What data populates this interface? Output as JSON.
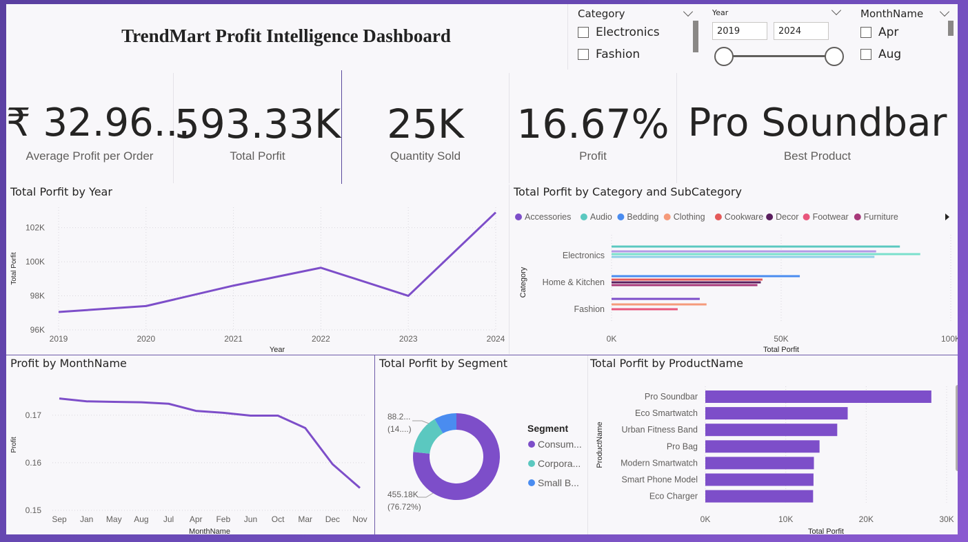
{
  "header": {
    "title": "TrendMart Profit Intelligence Dashboard"
  },
  "slicers": {
    "category": {
      "label": "Category",
      "options": [
        "Electronics",
        "Fashion"
      ]
    },
    "year": {
      "label": "Year",
      "from": "2019",
      "to": "2024"
    },
    "month": {
      "label": "MonthName",
      "options": [
        "Apr",
        "Aug"
      ]
    }
  },
  "kpis": [
    {
      "value": "₹ 32.96...",
      "label": "Average Profit per Order"
    },
    {
      "value": "593.33K",
      "label": "Total Porfit"
    },
    {
      "value": "25K",
      "label": "Quantity Sold"
    },
    {
      "value": "16.67%",
      "label": "Profit"
    },
    {
      "value": "Pro Soundbar",
      "label": "Best Product"
    }
  ],
  "colors": {
    "primary": "#7d4ec9",
    "grid": "#d8d6dc"
  },
  "chart_data": [
    {
      "id": "year",
      "type": "line",
      "title": "Total Porfit by Year",
      "xlabel": "Year",
      "ylabel": "Total Porfit",
      "x": [
        "2019",
        "2020",
        "2021",
        "2022",
        "2023",
        "2024"
      ],
      "values": [
        97050,
        97400,
        98600,
        99650,
        98000,
        102900
      ],
      "ylim": [
        96000,
        103200
      ],
      "yticks": [
        96000,
        98000,
        100000,
        102000
      ],
      "ytick_labels": [
        "96K",
        "98K",
        "100K",
        "102K"
      ],
      "grid": true
    },
    {
      "id": "catsub",
      "type": "bar",
      "title": "Total Porfit by Category and SubCategory",
      "xlabel": "Total Porfit",
      "ylabel": "Category",
      "legend_position": "top",
      "legend": [
        {
          "name": "Accessories",
          "color": "#7d4ec9"
        },
        {
          "name": "Audio",
          "color": "#5bc8c0"
        },
        {
          "name": "Bedding",
          "color": "#4a8cf0"
        },
        {
          "name": "Clothing",
          "color": "#f59a7a"
        },
        {
          "name": "Cookware",
          "color": "#e45a5a"
        },
        {
          "name": "Decor",
          "color": "#5a1e5e"
        },
        {
          "name": "Footwear",
          "color": "#e8567c"
        },
        {
          "name": "Furniture",
          "color": "#a8397a"
        }
      ],
      "categories": [
        "Electronics",
        "Home & Kitchen",
        "Fashion"
      ],
      "bars": [
        [
          {
            "color": "#5bc8c0",
            "value": 85000
          },
          {
            "color": "#b39ae6",
            "value": 78000
          },
          {
            "color": "#7be0cc",
            "value": 91000
          },
          {
            "color": "#8fd0e6",
            "value": 77500
          }
        ],
        [
          {
            "color": "#4a8cf0",
            "value": 55500
          },
          {
            "color": "#e45a5a",
            "value": 44500
          },
          {
            "color": "#5a1e5e",
            "value": 44000
          },
          {
            "color": "#a8397a",
            "value": 43000
          }
        ],
        [
          {
            "color": "#7d4ec9",
            "value": 26000
          },
          {
            "color": "#f59a7a",
            "value": 28000
          },
          {
            "color": "#e8567c",
            "value": 19500
          }
        ]
      ],
      "xlim": [
        0,
        100000
      ],
      "xticks": [
        0,
        50000,
        100000
      ],
      "xtick_labels": [
        "0K",
        "50K",
        "100K"
      ]
    },
    {
      "id": "month",
      "type": "line",
      "title": "Profit by MonthName",
      "xlabel": "MonthName",
      "ylabel": "Profit",
      "x": [
        "Sep",
        "Jan",
        "May",
        "Aug",
        "Jul",
        "Apr",
        "Feb",
        "Jun",
        "Oct",
        "Mar",
        "Dec",
        "Nov"
      ],
      "values": [
        0.1735,
        0.1729,
        0.1728,
        0.1727,
        0.1724,
        0.1709,
        0.1705,
        0.1699,
        0.1699,
        0.1673,
        0.1597,
        0.1547
      ],
      "ylim": [
        0.15,
        0.1775
      ],
      "yticks": [
        0.15,
        0.16,
        0.17
      ],
      "ytick_labels": [
        "0.15",
        "0.16",
        "0.17"
      ],
      "grid": true
    },
    {
      "id": "segment",
      "type": "pie",
      "title": "Total Porfit by Segment",
      "legend_title": "Segment",
      "legend_position": "right",
      "slices": [
        {
          "name": "Consum...",
          "value": 76.72,
          "color": "#7d4ec9"
        },
        {
          "name": "Corpora...",
          "value": 14.9,
          "color": "#5bc8c0"
        },
        {
          "name": "Small B...",
          "value": 8.38,
          "color": "#4a8cf0"
        }
      ],
      "labels": [
        {
          "line1": "455.18K",
          "line2": "(76.72%)"
        },
        {
          "line1": "88.2...",
          "line2": "(14....)"
        }
      ]
    },
    {
      "id": "product",
      "type": "bar",
      "title": "Total Porfit by ProductName",
      "xlabel": "Total Porfit",
      "ylabel": "ProductName",
      "categories": [
        "Pro Soundbar",
        "Eco Smartwatch",
        "Urban Fitness Band",
        "Pro Bag",
        "Modern Smartwatch",
        "Smart Phone Model",
        "Eco Charger"
      ],
      "values": [
        28100,
        17700,
        16400,
        14200,
        13500,
        13450,
        13400
      ],
      "xlim": [
        0,
        30000
      ],
      "xticks": [
        0,
        10000,
        20000,
        30000
      ],
      "xtick_labels": [
        "0K",
        "10K",
        "20K",
        "30K"
      ]
    }
  ]
}
